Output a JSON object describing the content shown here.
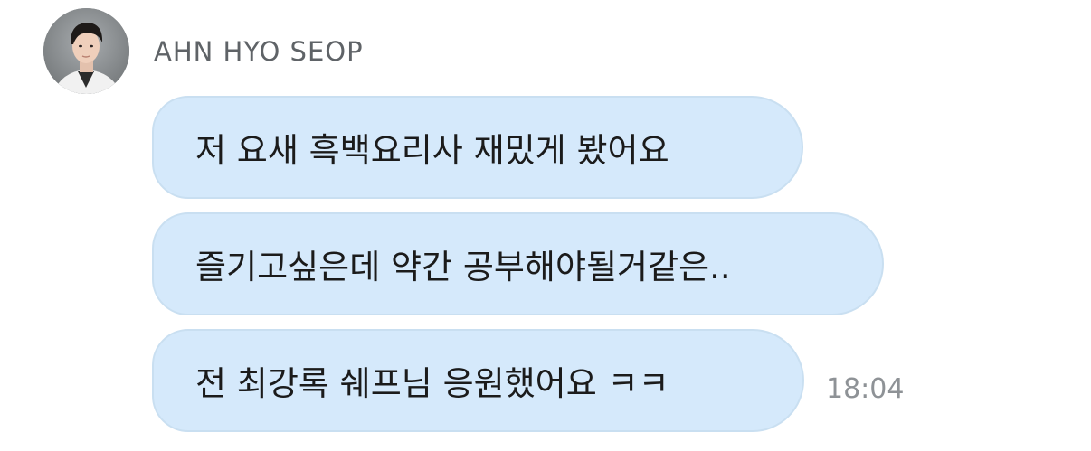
{
  "chat": {
    "sender": "AHN HYO SEOP",
    "avatar_icon": "profile-photo",
    "messages": [
      {
        "text": "저 요새 흑백요리사 재밌게 봤어요"
      },
      {
        "text": "즐기고싶은데 약간 공부해야될거같은.."
      },
      {
        "text": "전 최강록 쉐프님 응원했어요 ㅋㅋ"
      }
    ],
    "timestamp": "18:04"
  },
  "colors": {
    "bubble": "#d5e9fb",
    "bubble_border": "#c9dff1",
    "sender_text": "#5f6367",
    "timestamp_text": "#8e9296"
  }
}
